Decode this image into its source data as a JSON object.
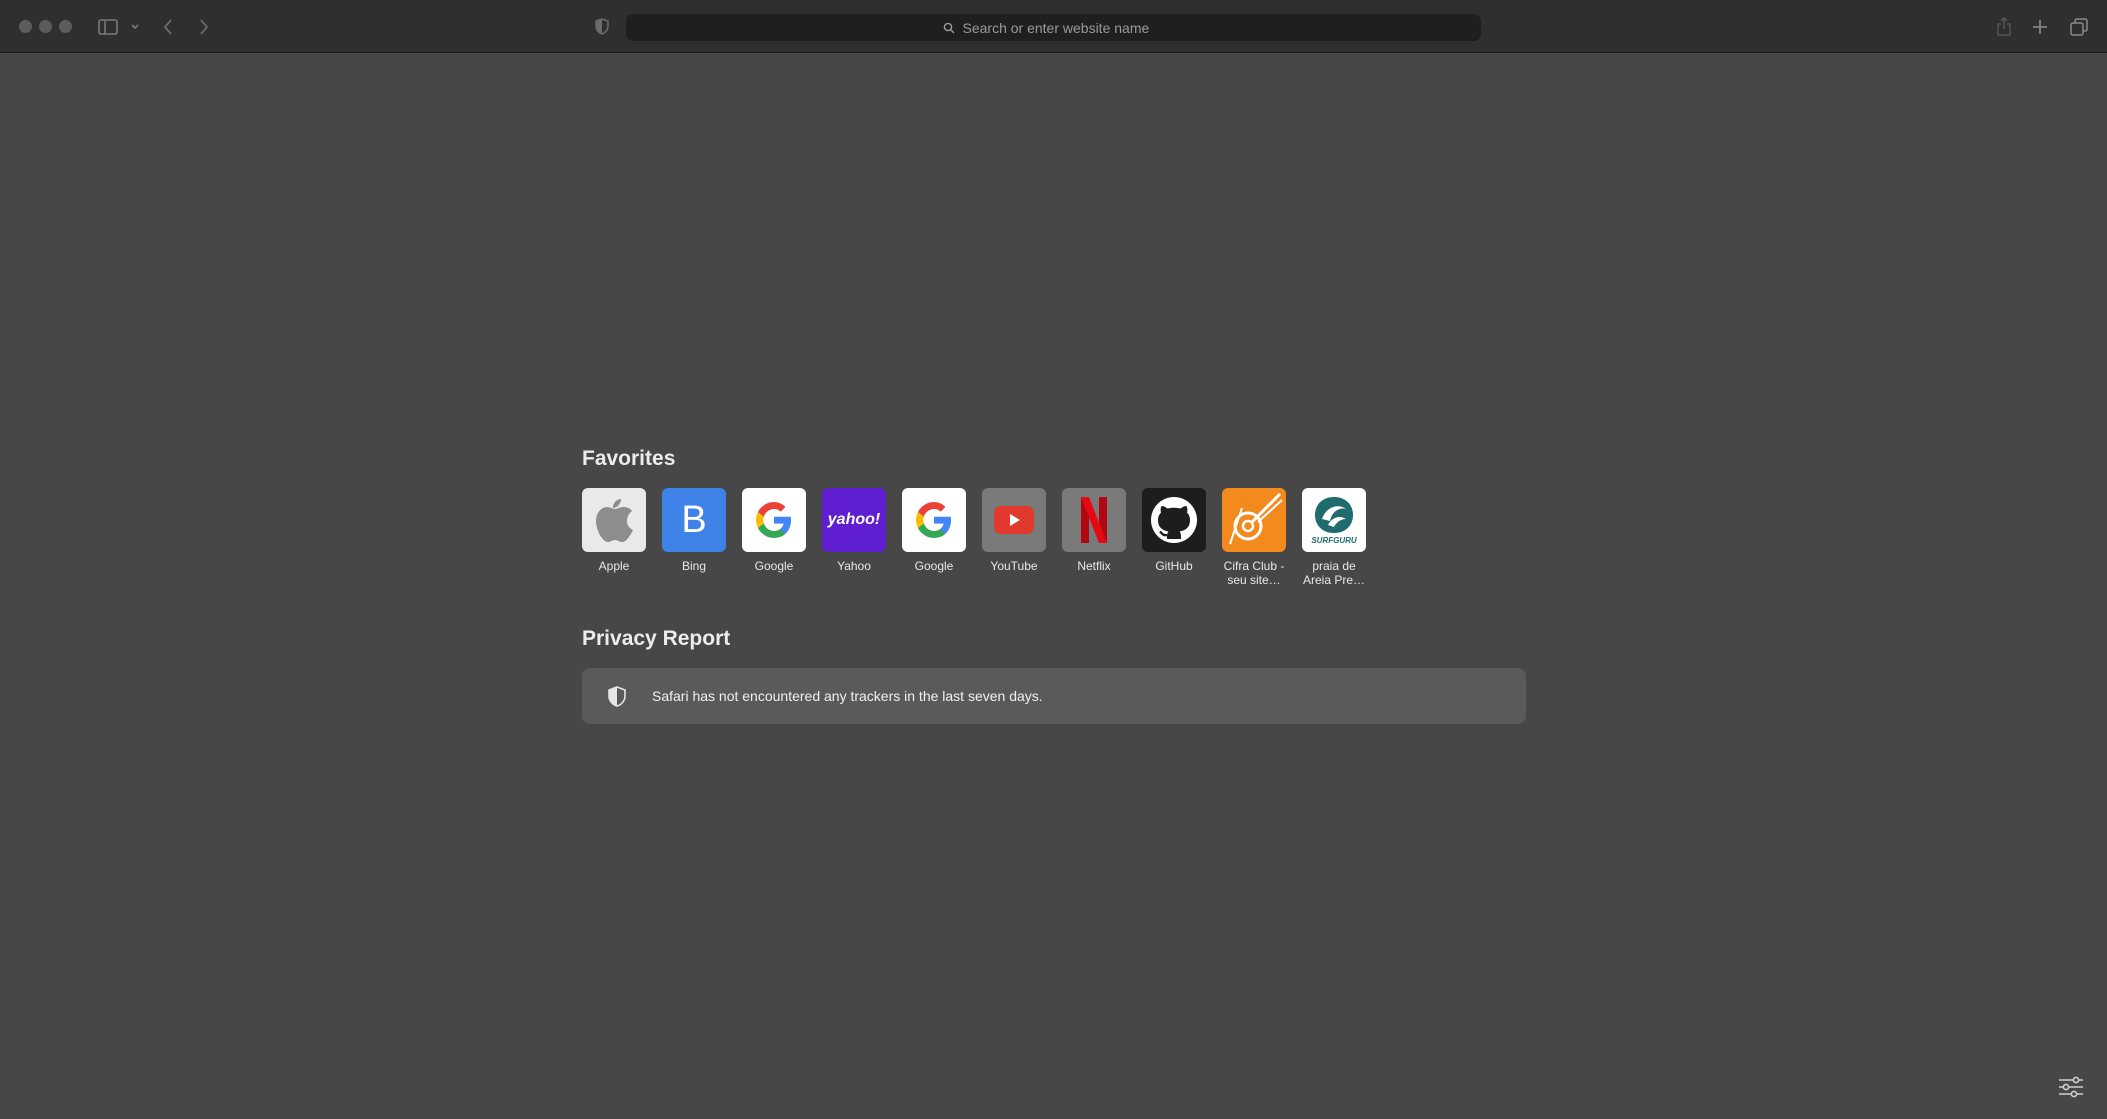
{
  "toolbar": {
    "address_placeholder": "Search or enter website name",
    "icons": [
      "sidebar-icon",
      "chevron-down-icon",
      "back-icon",
      "forward-icon",
      "privacy-shield-icon",
      "search-icon",
      "share-icon",
      "new-tab-icon",
      "tab-overview-icon"
    ]
  },
  "favorites": {
    "title": "Favorites",
    "items": [
      {
        "label": "Apple",
        "bg": "#e9e9e9"
      },
      {
        "label": "Bing",
        "bg": "#3f82e8",
        "letter": "B"
      },
      {
        "label": "Google",
        "bg": "#ffffff"
      },
      {
        "label": "Yahoo",
        "bg": "#5f1fd1",
        "letter": "yahoo!"
      },
      {
        "label": "Google",
        "bg": "#ffffff"
      },
      {
        "label": "YouTube",
        "bg": "#7a7a7a"
      },
      {
        "label": "Netflix",
        "bg": "#7a7a7a"
      },
      {
        "label": "GitHub",
        "bg": "#1d1d1d"
      },
      {
        "label": "Cifra Club - seu site…",
        "bg": "#f28a1e"
      },
      {
        "label": "praia de Areia Pre…",
        "bg": "#ffffff",
        "letter": "SURFGURU"
      }
    ]
  },
  "privacy": {
    "title": "Privacy Report",
    "message": "Safari has not encountered any trackers in the last seven days."
  },
  "colors": {
    "toolbar_bg": "#2f2f2f",
    "page_bg": "#474747",
    "card_bg": "#5a5a5a"
  }
}
